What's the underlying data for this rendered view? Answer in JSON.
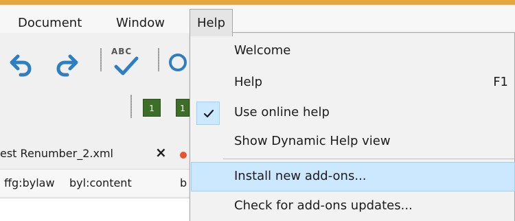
{
  "menubar": {
    "items": [
      {
        "label": "Document"
      },
      {
        "label": "Window"
      },
      {
        "label": "Help"
      }
    ]
  },
  "toolbar": {
    "icons": [
      "undo-icon",
      "redo-icon",
      "spellcheck-icon",
      "find-icon"
    ],
    "spellcheck_label": "ABC",
    "badges": [
      "1",
      "1"
    ]
  },
  "tabs": {
    "active_title": "est Renumber_2.xml",
    "close_glyph": "×"
  },
  "breadcrumb": {
    "items": [
      "ffg:bylaw",
      "byl:content",
      "b"
    ]
  },
  "help_menu": {
    "items": [
      {
        "label": "Welcome",
        "shortcut": ""
      },
      {
        "label": "Help",
        "shortcut": "F1"
      },
      {
        "label": "Use online help",
        "shortcut": "",
        "checked": true
      },
      {
        "label": "Show Dynamic Help view",
        "shortcut": ""
      },
      {
        "label": "Install new add-ons...",
        "shortcut": "",
        "highlighted": true
      },
      {
        "label": "Check for add-ons updates...",
        "shortcut": ""
      }
    ]
  },
  "colors": {
    "accent": "#e8a63e",
    "icon_blue": "#2d7fc1",
    "badge_green": "#3d6e27",
    "highlight": "#cce8ff",
    "tab_dot": "#e8532a"
  }
}
